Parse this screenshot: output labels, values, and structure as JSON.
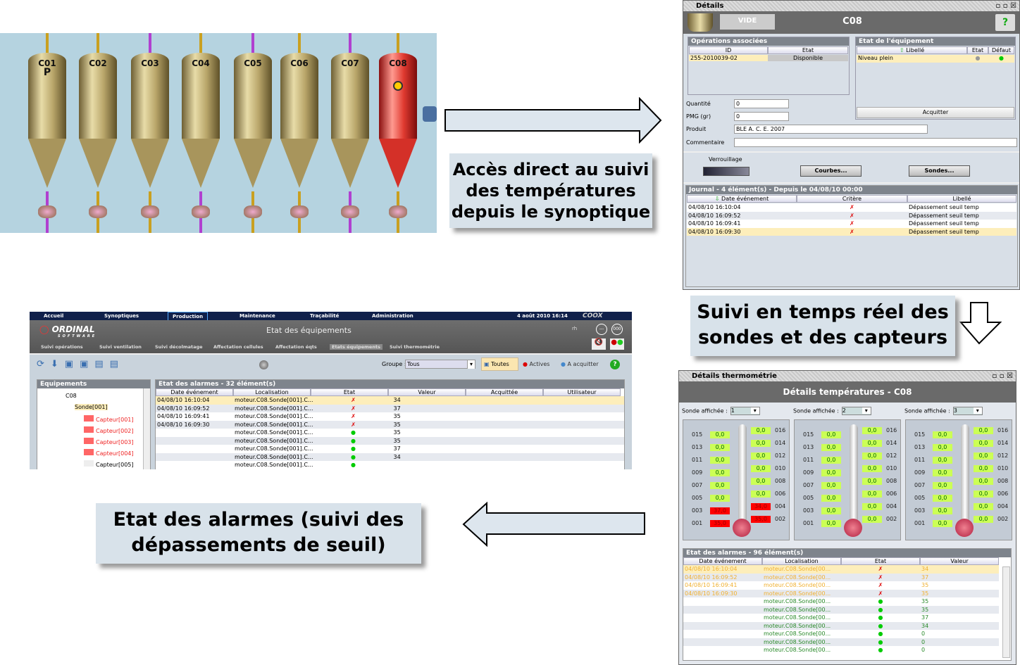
{
  "synoptic": {
    "silos": [
      "C01",
      "C02",
      "C03",
      "C04",
      "C05",
      "C06",
      "C07",
      "C08"
    ],
    "marker": "P",
    "highlight_color": "#e03a30"
  },
  "callouts": {
    "c1": [
      "Accès direct au suivi",
      "des températures",
      "depuis le synoptique"
    ],
    "c2": [
      "Suivi en temps réel des",
      "sondes et des capteurs"
    ],
    "c3": [
      "Etat des alarmes (suivi des",
      "dépassements de seuil)"
    ]
  },
  "details": {
    "title": "Détails",
    "state_btn": "VIDE",
    "equipment": "C08",
    "ops_title": "Opérations associées",
    "ops_cols": [
      "ID",
      "Etat"
    ],
    "ops_rows": [
      [
        "255-2010039-02",
        "Disponible"
      ]
    ],
    "eq_title": "Etat de l'équipement",
    "eq_cols": [
      "Libellé",
      "Etat",
      "Défaut"
    ],
    "eq_rows": [
      [
        "Niveau plein"
      ]
    ],
    "ack": "Acquitter",
    "fields": [
      {
        "label": "Quantité",
        "value": "0"
      },
      {
        "label": "PMG (gr)",
        "value": "0"
      },
      {
        "label": "Produit",
        "value": "BLE    A. C. E. 2007"
      },
      {
        "label": "Commentaire",
        "value": ""
      }
    ],
    "lock": "Verrouillage",
    "courbes": "Courbes...",
    "sondes": "Sondes...",
    "journal_title": "Journal - 4 élément(s) - Depuis le 04/08/10 00:00",
    "journal_cols": [
      "Date événement",
      "Critère",
      "Libellé"
    ],
    "journal_rows": [
      [
        "04/08/10 16:10:04",
        "Dépassement seuil temp"
      ],
      [
        "04/08/10 16:09:52",
        "Dépassement seuil temp"
      ],
      [
        "04/08/10 16:09:41",
        "Dépassement seuil temp"
      ],
      [
        "04/08/10 16:09:30",
        "Dépassement seuil temp"
      ]
    ]
  },
  "app": {
    "menu": [
      "Accueil",
      "Synoptiques",
      "Production",
      "Maintenance",
      "Traçabilité",
      "Administration"
    ],
    "datetime": "4 août 2010 16:14",
    "brand": "COOX",
    "logo": "ORDINAL",
    "logo_sub": "SOFTWARE",
    "page_title": "Etat des équipements",
    "user": "rh",
    "btn1": "---",
    "btn2": "000",
    "submenu": [
      "Suivi opérations",
      "Suivi ventilation",
      "Suivi décolmatage",
      "Affectation cellules",
      "Affectation éqts",
      "Etats équipements",
      "Suivi thermométrie"
    ],
    "group_label": "Groupe :",
    "group_value": "Tous",
    "filters": [
      "Toutes",
      "Actives",
      "A acquitter"
    ],
    "tree_title": "Equipements",
    "tree": [
      "C08",
      "Sonde[001]",
      "Capteur[001]",
      "Capteur[002]",
      "Capteur[003]",
      "Capteur[004]",
      "Capteur[005]"
    ],
    "alarms_title": "Etat des alarmes - 32 élément(s)",
    "alarm_cols": [
      "Date événement",
      "Localisation",
      "Etat",
      "Valeur",
      "Acquittée",
      "Utilisateur"
    ],
    "alarm_rows": [
      [
        "04/08/10 16:10:04",
        "moteur.C08.Sonde[001].C...",
        "alarm",
        "34"
      ],
      [
        "04/08/10 16:09:52",
        "moteur.C08.Sonde[001].C...",
        "alarm",
        "37"
      ],
      [
        "04/08/10 16:09:41",
        "moteur.C08.Sonde[001].C...",
        "alarm",
        "35"
      ],
      [
        "04/08/10 16:09:30",
        "moteur.C08.Sonde[001].C...",
        "alarm",
        "35"
      ],
      [
        "",
        "moteur.C08.Sonde[001].C...",
        "ok",
        "35"
      ],
      [
        "",
        "moteur.C08.Sonde[001].C...",
        "ok",
        "35"
      ],
      [
        "",
        "moteur.C08.Sonde[001].C...",
        "ok",
        "37"
      ],
      [
        "",
        "moteur.C08.Sonde[001].C...",
        "ok",
        "34"
      ],
      [
        "",
        "moteur.C08.Sonde[001].C...",
        "ok",
        ""
      ]
    ]
  },
  "thermo": {
    "title": "Détails thermométrie",
    "header": "Détails températures  -  C08",
    "sonde_label": "Sonde affichée :",
    "probes": [
      {
        "sonde": "1",
        "left": [
          [
            "015",
            "0,0"
          ],
          [
            "013",
            "0,0"
          ],
          [
            "011",
            "0,0"
          ],
          [
            "009",
            "0,0"
          ],
          [
            "007",
            "0,0"
          ],
          [
            "005",
            "0,0"
          ],
          [
            "003",
            "37,0"
          ],
          [
            "001",
            "35,0"
          ]
        ],
        "right": [
          [
            "016",
            "0,0"
          ],
          [
            "014",
            "0,0"
          ],
          [
            "012",
            "0,0"
          ],
          [
            "010",
            "0,0"
          ],
          [
            "008",
            "0,0"
          ],
          [
            "006",
            "0,0"
          ],
          [
            "004",
            "34,0"
          ],
          [
            "002",
            "35,0"
          ]
        ]
      },
      {
        "sonde": "2",
        "left": [
          [
            "015",
            "0,0"
          ],
          [
            "013",
            "0,0"
          ],
          [
            "011",
            "0,0"
          ],
          [
            "009",
            "0,0"
          ],
          [
            "007",
            "0,0"
          ],
          [
            "005",
            "0,0"
          ],
          [
            "003",
            "0,0"
          ],
          [
            "001",
            "0,0"
          ]
        ],
        "right": [
          [
            "016",
            "0,0"
          ],
          [
            "014",
            "0,0"
          ],
          [
            "012",
            "0,0"
          ],
          [
            "010",
            "0,0"
          ],
          [
            "008",
            "0,0"
          ],
          [
            "006",
            "0,0"
          ],
          [
            "004",
            "0,0"
          ],
          [
            "002",
            "0,0"
          ]
        ]
      },
      {
        "sonde": "3",
        "left": [
          [
            "015",
            "0,0"
          ],
          [
            "013",
            "0,0"
          ],
          [
            "011",
            "0,0"
          ],
          [
            "009",
            "0,0"
          ],
          [
            "007",
            "0,0"
          ],
          [
            "005",
            "0,0"
          ],
          [
            "003",
            "0,0"
          ],
          [
            "001",
            "0,0"
          ]
        ],
        "right": [
          [
            "016",
            "0,0"
          ],
          [
            "014",
            "0,0"
          ],
          [
            "012",
            "0,0"
          ],
          [
            "010",
            "0,0"
          ],
          [
            "008",
            "0,0"
          ],
          [
            "006",
            "0,0"
          ],
          [
            "004",
            "0,0"
          ],
          [
            "002",
            "0,0"
          ]
        ]
      }
    ],
    "alarms_title": "Etat des alarmes - 96 élément(s)",
    "alarm_cols": [
      "Date événement",
      "Localisation",
      "Etat",
      "Valeur"
    ],
    "alarm_rows": [
      [
        "04/08/10 16:10:04",
        "moteur.C08.Sonde[00...",
        "alarm",
        "34"
      ],
      [
        "04/08/10 16:09:52",
        "moteur.C08.Sonde[00...",
        "alarm",
        "37"
      ],
      [
        "04/08/10 16:09:41",
        "moteur.C08.Sonde[00...",
        "alarm",
        "35"
      ],
      [
        "04/08/10 16:09:30",
        "moteur.C08.Sonde[00...",
        "alarm",
        "35"
      ],
      [
        "",
        "moteur.C08.Sonde[00...",
        "ok",
        "35"
      ],
      [
        "",
        "moteur.C08.Sonde[00...",
        "ok",
        "35"
      ],
      [
        "",
        "moteur.C08.Sonde[00...",
        "ok",
        "37"
      ],
      [
        "",
        "moteur.C08.Sonde[00...",
        "ok",
        "34"
      ],
      [
        "",
        "moteur.C08.Sonde[00...",
        "ok",
        "0"
      ],
      [
        "",
        "moteur.C08.Sonde[00...",
        "ok",
        "0"
      ],
      [
        "",
        "moteur.C08.Sonde[00...",
        "ok",
        "0"
      ]
    ]
  }
}
